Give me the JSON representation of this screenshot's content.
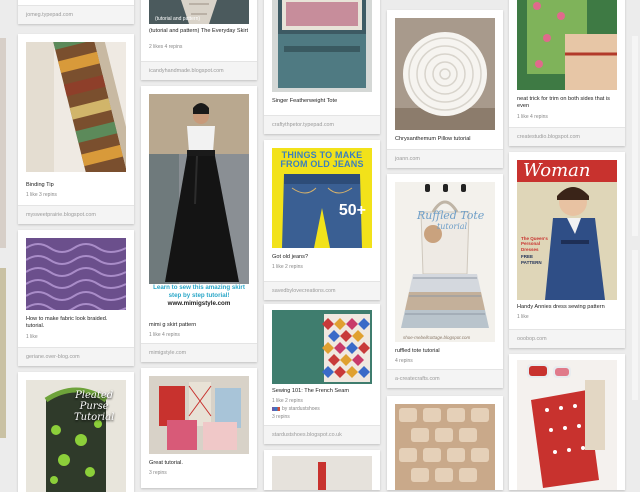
{
  "pins": {
    "p_top_left": {
      "source": "jomeg.typepad.com"
    },
    "p_skirt_top": {
      "image_text": "(tutorial and pattern)",
      "title": "(tutorial and pattern) The Everyday Skirt",
      "meta": "2 likes   4 repins",
      "source": "icandyhandmade.blogspot.com"
    },
    "p_tote": {
      "title": "Singer Featherweight Tote",
      "source": "craftythpetor.typepad.com"
    },
    "p_chrys": {
      "title": "Chrysanthemum Pillow tutorial",
      "source": "joann.com"
    },
    "p_neat": {
      "title": "neat trick for trim on both sides that is even",
      "meta": "1 like   4 repins",
      "source": "createstudio.blogspot.com"
    },
    "p_binding": {
      "title": "Binding Tip",
      "meta": "1 like   3 repins",
      "source": "mysweetprairie.blogspot.com"
    },
    "p_maxi": {
      "image_text": "www.mimigstyle.com",
      "caption_line1": "Learn to sew this amazing skirt",
      "caption_line2": "step by step tutorial!",
      "caption_url": "www.mimigstyle.com",
      "title": "mimi g skirt pattern",
      "meta": "1 like   4 repins",
      "source": "mimigstyle.com"
    },
    "p_jeans": {
      "banner_line1": "THINGS TO MAKE",
      "banner_line2": "FROM OLD JEANS",
      "count": "50+",
      "title": "Got old jeans?",
      "meta": "1 like   2 repins",
      "source": "savedbylovecreations.com"
    },
    "p_ruffled": {
      "script_line1": "Ruffled Tote",
      "script_line2": "tutorial",
      "watermark": "shoe-mebellcottage.blogspot.com",
      "title": "ruffled tote tutorial",
      "meta": "4 repins",
      "source": "a-createcrafts.com"
    },
    "p_woman": {
      "mast": "Woman",
      "cover_line1": "The Queen's Personal Dresses",
      "cover_line2": "FREE PATTERN",
      "title": "Handy Annies dress sewing pattern",
      "meta": "1 like",
      "source": "ooobop.com"
    },
    "p_fabric": {
      "title": "How to make fabric look braided. tutorial.",
      "meta": "1 like",
      "source": "geriane.over-blog.com"
    },
    "p_seam": {
      "title": "Sewing 101: The French Seam",
      "meta": "1 like   2 repins",
      "via": "by stardustshoes",
      "meta2": "3 repins",
      "source": "stardustshoes.blogspot.co.uk"
    },
    "p_purse": {
      "line1": "Pleated",
      "line2": "Purse",
      "line3": "Tutorial"
    },
    "p_great": {
      "title": "Great tutorial.",
      "meta": "3 repins"
    }
  },
  "colors": {
    "background": "#ececec",
    "card": "#ffffff",
    "source_bar": "#f4f4f4",
    "jeans_banner": "#f2e21a",
    "script_blue": "#6f9fc8"
  }
}
